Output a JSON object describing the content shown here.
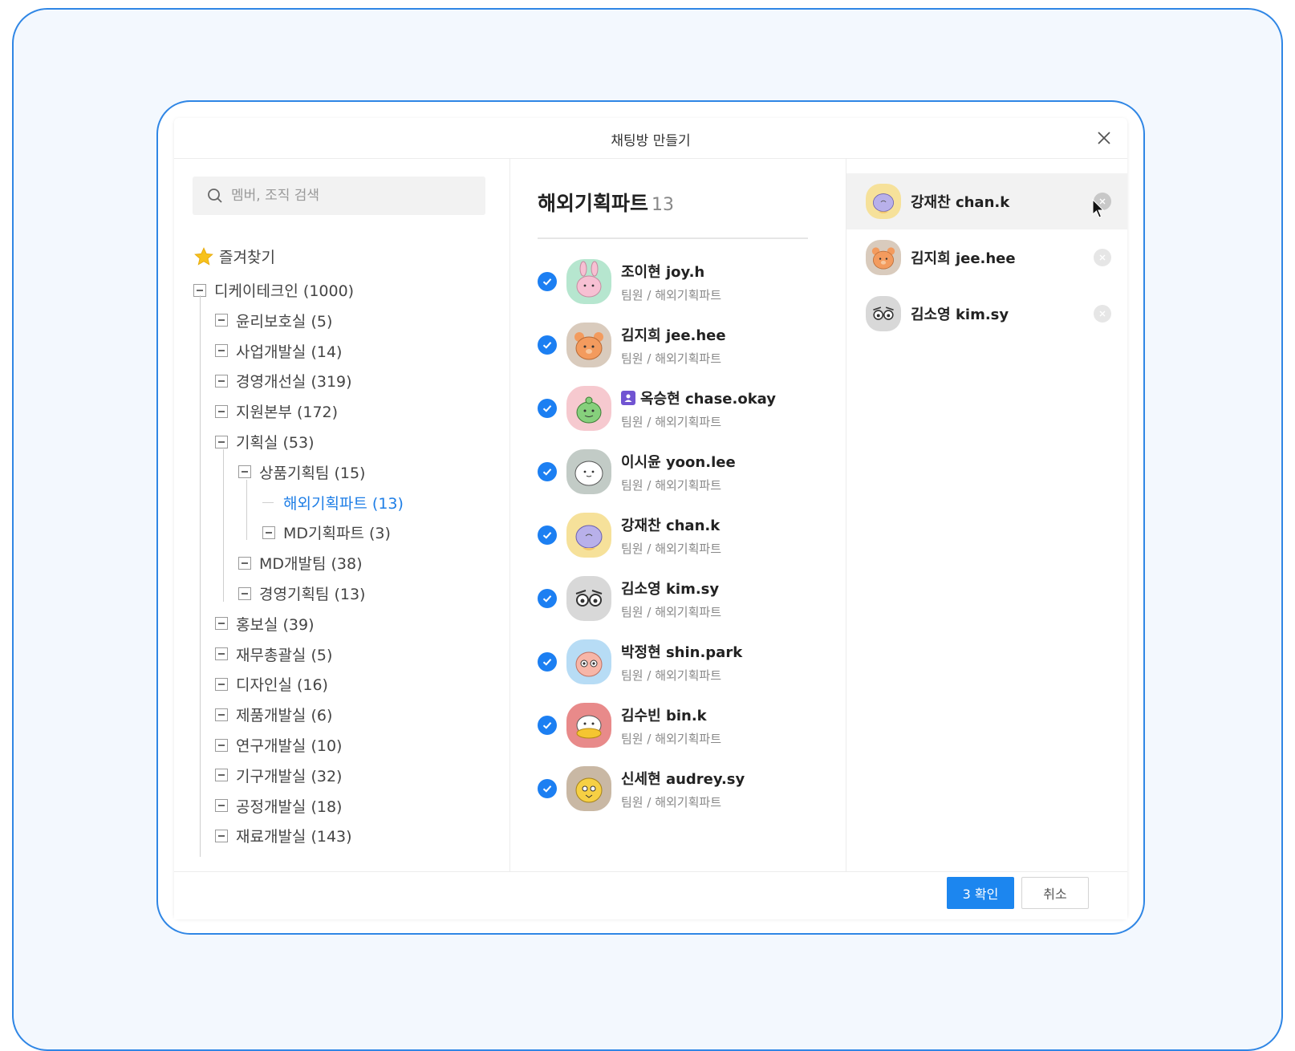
{
  "dialog": {
    "title": "채팅방 만들기"
  },
  "search": {
    "placeholder": "멤버, 조직 검색"
  },
  "favorites": {
    "label": "즐겨찾기"
  },
  "tree": [
    {
      "label": "디케이테크인 (1000)",
      "level": 0,
      "selected": false
    },
    {
      "label": "윤리보호실 (5)",
      "level": 1,
      "selected": false
    },
    {
      "label": "사업개발실 (14)",
      "level": 1,
      "selected": false
    },
    {
      "label": "경영개선실 (319)",
      "level": 1,
      "selected": false
    },
    {
      "label": "지원본부 (172)",
      "level": 1,
      "selected": false
    },
    {
      "label": "기획실  (53)",
      "level": 1,
      "selected": false
    },
    {
      "label": "상품기획팀 (15)",
      "level": 2,
      "selected": false
    },
    {
      "label": "해외기획파트 (13)",
      "level": 3,
      "selected": true,
      "leaf": true
    },
    {
      "label": "MD기획파트 (3)",
      "level": 3,
      "selected": false
    },
    {
      "label": "MD개발팀 (38)",
      "level": 2,
      "selected": false
    },
    {
      "label": "경영기획팀 (13)",
      "level": 2,
      "selected": false
    },
    {
      "label": "홍보실 (39)",
      "level": 1,
      "selected": false
    },
    {
      "label": "재무총괄실 (5)",
      "level": 1,
      "selected": false
    },
    {
      "label": "디자인실 (16)",
      "level": 1,
      "selected": false
    },
    {
      "label": "제품개발실 (6)",
      "level": 1,
      "selected": false
    },
    {
      "label": "연구개발실 (10)",
      "level": 1,
      "selected": false
    },
    {
      "label": "기구개발실 (32)",
      "level": 1,
      "selected": false
    },
    {
      "label": "공정개발실 (18)",
      "level": 1,
      "selected": false
    },
    {
      "label": "재료개발실 (143)",
      "level": 1,
      "selected": false
    }
  ],
  "department": {
    "name": "해외기획파트",
    "count": "13"
  },
  "members": [
    {
      "name": "조이현 joy.h",
      "sub": "팀원 / 해외기획파트",
      "checked": true,
      "avatar": "rabbit-avatar",
      "color": "#b6e6cf",
      "badge": false
    },
    {
      "name": "김지희 jee.hee",
      "sub": "팀원 / 해외기획파트",
      "checked": true,
      "avatar": "bear-avatar",
      "color": "#d9cbbd",
      "badge": false
    },
    {
      "name": "옥승현 chase.okay",
      "sub": "팀원 / 해외기획파트",
      "checked": true,
      "avatar": "croc-avatar",
      "color": "#f6c9cf",
      "badge": true
    },
    {
      "name": "이시윤 yoon.lee",
      "sub": "팀원 / 해외기획파트",
      "checked": true,
      "avatar": "seal-avatar",
      "color": "#c2cbc6",
      "badge": false
    },
    {
      "name": "강재찬 chan.k",
      "sub": "팀원 / 해외기획파트",
      "checked": true,
      "avatar": "lion-avatar",
      "color": "#f6e19a",
      "badge": false
    },
    {
      "name": "김소영 kim.sy",
      "sub": "팀원 / 해외기획파트",
      "checked": true,
      "avatar": "owl-avatar",
      "color": "#d8d8d8",
      "badge": false
    },
    {
      "name": "박정현 shin.park",
      "sub": "팀원 / 해외기획파트",
      "checked": true,
      "avatar": "peach-avatar",
      "color": "#b7dcf5",
      "badge": false
    },
    {
      "name": "김수빈 bin.k",
      "sub": "팀원 / 해외기획파트",
      "checked": true,
      "avatar": "duck-avatar",
      "color": "#e88a8a",
      "badge": false
    },
    {
      "name": "신세현 audrey.sy",
      "sub": "팀원 / 해외기획파트",
      "checked": true,
      "avatar": "chick-avatar",
      "color": "#c9b8a4",
      "badge": false
    }
  ],
  "selected": [
    {
      "name": "강재찬 chan.k",
      "avatar": "lion-avatar",
      "color": "#f6e19a",
      "hover": true
    },
    {
      "name": "김지희 jee.hee",
      "avatar": "bear-avatar",
      "color": "#d9cbbd",
      "hover": false
    },
    {
      "name": "김소영 kim.sy",
      "avatar": "owl-avatar",
      "color": "#d8d8d8",
      "hover": false
    }
  ],
  "footer": {
    "confirm_label": "3 확인",
    "cancel_label": "취소"
  },
  "colors": {
    "accent": "#1c86ef",
    "selected_text": "#1e7ee6",
    "frame": "#2f86e5"
  }
}
